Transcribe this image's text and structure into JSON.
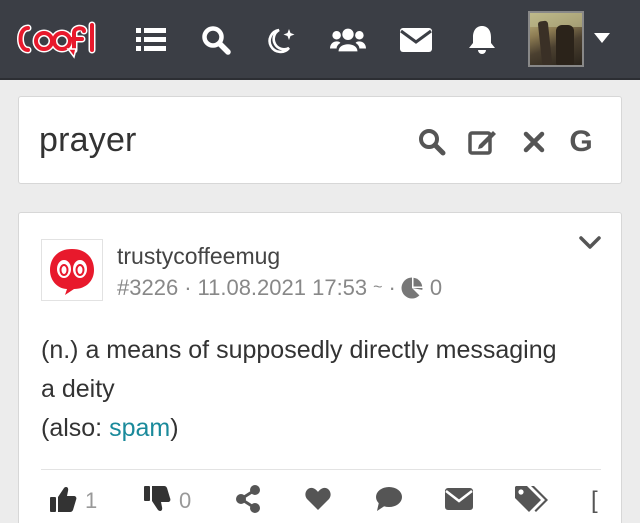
{
  "navbar": {
    "logo_text": "coofi",
    "icons": [
      "list-icon",
      "search-icon",
      "night-mode-icon",
      "users-icon",
      "envelope-icon",
      "bell-icon"
    ],
    "dropdown_icon": "caret-down-icon",
    "bg_color": "#3b3e45",
    "logo_color": "#e8192c"
  },
  "search": {
    "query": "prayer",
    "icons": [
      "search-icon",
      "edit-icon",
      "close-icon",
      "google-icon"
    ],
    "google_letter": "G"
  },
  "post": {
    "username": "trustycoffeemug",
    "post_id": "#3226",
    "sep1": "·",
    "datetime": "11.08.2021 17:53",
    "tilde": "~",
    "sep2": "·",
    "views": "0",
    "body_line1": "(n.) a means of supposedly directly messaging",
    "body_line2": "a deity",
    "body_line3_prefix": "(also: ",
    "body_link": "spam",
    "body_line3_suffix": ")",
    "likes": "1",
    "dislikes": "0",
    "link_color": "#1a8a9b",
    "actions": [
      "thumbs-up-icon",
      "thumbs-down-icon",
      "share-icon",
      "heart-icon",
      "comment-icon",
      "envelope-icon",
      "tags-icon",
      "bracket-icon"
    ],
    "partial_action_glyph": "["
  }
}
